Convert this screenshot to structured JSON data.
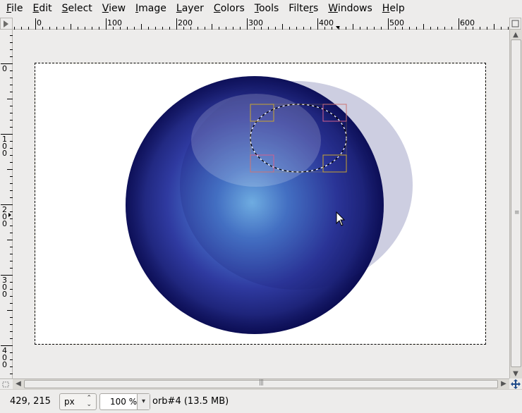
{
  "menubar": {
    "items": [
      {
        "mnemonic": "F",
        "rest": "ile"
      },
      {
        "mnemonic": "E",
        "rest": "dit"
      },
      {
        "mnemonic": "S",
        "rest": "elect"
      },
      {
        "mnemonic": "V",
        "rest": "iew"
      },
      {
        "mnemonic": "I",
        "rest": "mage"
      },
      {
        "mnemonic": "L",
        "rest": "ayer"
      },
      {
        "mnemonic": "C",
        "rest": "olors"
      },
      {
        "mnemonic": "T",
        "rest": "ools"
      },
      {
        "mnemonic": "",
        "pre": "Filte",
        "mid": "r",
        "rest": "s"
      },
      {
        "mnemonic": "W",
        "rest": "indows"
      },
      {
        "mnemonic": "H",
        "rest": "elp"
      }
    ]
  },
  "rulers": {
    "horizontal_labels": [
      "0",
      "100",
      "200",
      "300",
      "400",
      "500",
      "600"
    ],
    "vertical_labels": [
      "0",
      "100",
      "200",
      "300",
      "400"
    ]
  },
  "status": {
    "coords": "429, 215",
    "unit": "px",
    "zoom": "100 %",
    "image_info": "orb#4 (13.5 MB)"
  },
  "colors": {
    "orb_dark": "#0d0f52",
    "orb_mid": "#3346a8",
    "orb_light": "#7fd0ff",
    "selection_handle_yellow": "#c9a531",
    "selection_handle_pink": "#d0608f"
  },
  "icons": {
    "ruler_corner": "triangle-right-icon",
    "navigate": "move-arrows-icon",
    "pointer": "mouse-pointer-icon"
  }
}
